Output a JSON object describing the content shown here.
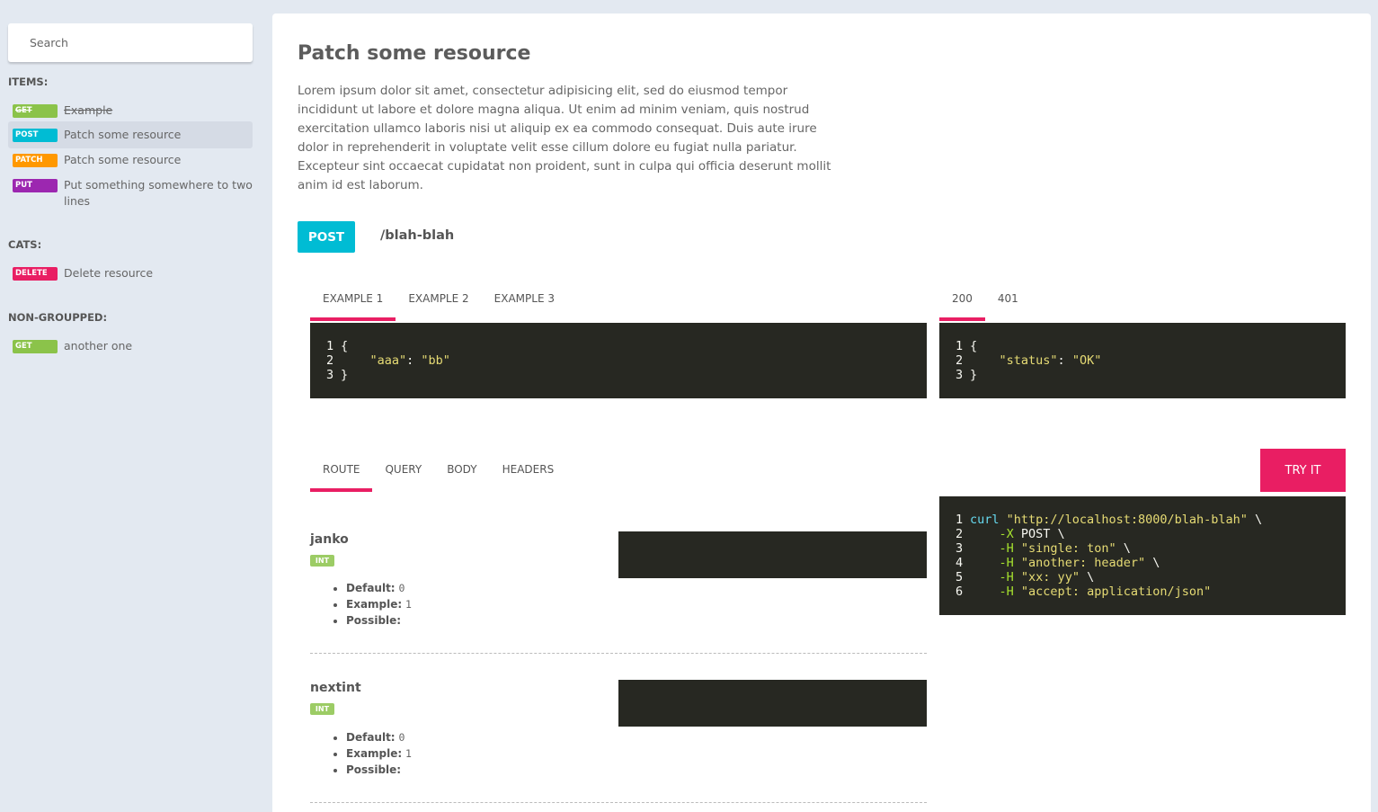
{
  "sidebar": {
    "search_placeholder": "Search",
    "groups": [
      {
        "title": "ITEMS:",
        "items": [
          {
            "method": "GET",
            "label": "Example",
            "deprecated": true,
            "color": "#8bc34a"
          },
          {
            "method": "POST",
            "label": "Patch some resource",
            "active": true,
            "color": "#00bcd4"
          },
          {
            "method": "PATCH",
            "label": "Patch some resource",
            "color": "#ff9800"
          },
          {
            "method": "PUT",
            "label": "Put something somewhere to two lines",
            "color": "#9c27b0"
          }
        ]
      },
      {
        "title": "CATS:",
        "items": [
          {
            "method": "DELETE",
            "label": "Delete resource",
            "color": "#e91e63"
          }
        ]
      },
      {
        "title": "NON-GROUPPED:",
        "items": [
          {
            "method": "GET",
            "label": "another one",
            "color": "#8bc34a"
          }
        ]
      }
    ]
  },
  "main": {
    "title": "Patch some resource",
    "description": "Lorem ipsum dolor sit amet, consectetur adipisicing elit, sed do eiusmod tempor incididunt ut labore et dolore magna aliqua. Ut enim ad minim veniam, quis nostrud exercitation ullamco laboris nisi ut aliquip ex ea commodo consequat. Duis aute irure dolor in reprehenderit in voluptate velit esse cillum dolore eu fugiat nulla pariatur. Excepteur sint occaecat cupidatat non proident, sunt in culpa qui officia deserunt mollit anim id est laborum.",
    "method": "POST",
    "method_color": "#00bcd4",
    "path": "/blah-blah",
    "example_tabs": [
      "EXAMPLE 1",
      "EXAMPLE 2",
      "EXAMPLE 3"
    ],
    "example_code": {
      "line_numbers": [
        "1",
        "2",
        "3"
      ],
      "open": "{",
      "key": "\"aaa\"",
      "colon": ": ",
      "value": "\"bb\"",
      "close": "}"
    },
    "response_tabs": [
      "200",
      "401"
    ],
    "response_code": {
      "line_numbers": [
        "1",
        "2",
        "3"
      ],
      "open": "{",
      "key": "\"status\"",
      "colon": ": ",
      "value": "\"OK\"",
      "close": "}"
    },
    "param_tabs": [
      "ROUTE",
      "QUERY",
      "BODY",
      "HEADERS"
    ],
    "try_label": "TRY IT",
    "accent_color": "#e91e63",
    "curl": {
      "line_numbers": [
        "1",
        "2",
        "3",
        "4",
        "5",
        "6"
      ],
      "cmd": "curl",
      "url": "\"http://localhost:8000/blah-blah\"",
      "cont": " \\",
      "x_flag": "-X",
      "x_val": " POST \\",
      "h_flag": "-H",
      "headers": [
        "\"single: ton\"",
        "\"another: header\"",
        "\"xx: yy\"",
        "\"accept: application/json\""
      ]
    },
    "params": [
      {
        "name": "janko",
        "type": "INT",
        "default_label": "Default:",
        "default": "0",
        "example_label": "Example:",
        "example": "1",
        "possible_label": "Possible:"
      },
      {
        "name": "nextint",
        "type": "INT",
        "default_label": "Default:",
        "default": "0",
        "example_label": "Example:",
        "example": "1",
        "possible_label": "Possible:"
      }
    ]
  }
}
